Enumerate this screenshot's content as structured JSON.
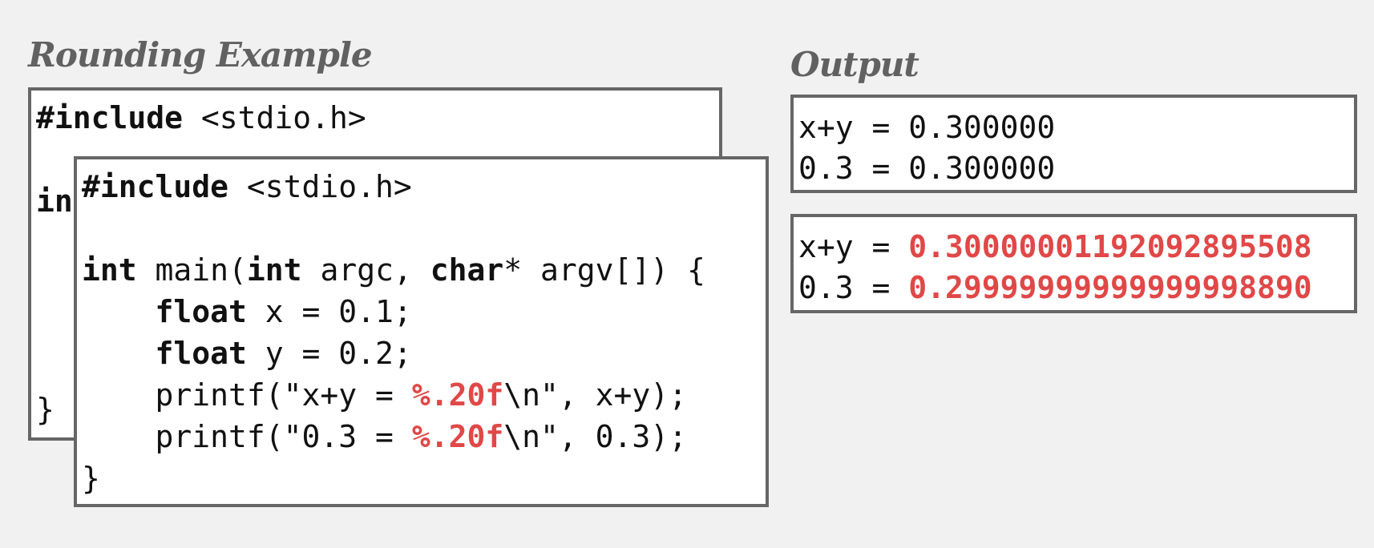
{
  "left": {
    "title": "Rounding Example",
    "back_code": {
      "line1_kw": "#include",
      "line1_rest": " <stdio.h>",
      "line3_kw": "in",
      "line8": "}"
    },
    "front_code": {
      "l1_kw": "#include",
      "l1_rest": " <stdio.h>",
      "l3": {
        "kw1": "int",
        "t1": " main(",
        "kw2": "int",
        "t2": " argc, ",
        "kw3": "char",
        "t3": "* argv[]) {"
      },
      "l4": {
        "indent": "    ",
        "kw": "float",
        "rest": " x = 0.1;"
      },
      "l5": {
        "indent": "    ",
        "kw": "float",
        "rest": " y = 0.2;"
      },
      "l6": {
        "pre": "    printf(\"x+y = ",
        "fmt": "%.20f",
        "post": "\\n\", x+y);"
      },
      "l7": {
        "pre": "    printf(\"0.3 = ",
        "fmt": "%.20f",
        "post": "\\n\", 0.3);"
      },
      "l8": "}"
    }
  },
  "right": {
    "title": "Output",
    "output1": [
      {
        "label": "x+y = ",
        "value": "0.300000"
      },
      {
        "label": "0.3 = ",
        "value": "0.300000"
      }
    ],
    "output2": [
      {
        "label": "x+y = ",
        "value": "0.30000001192092895508"
      },
      {
        "label": "0.3 = ",
        "value": "0.29999999999999998890"
      }
    ]
  },
  "colors": {
    "highlight": "#e04848",
    "border": "#666666",
    "background": "#f1f1f1"
  }
}
